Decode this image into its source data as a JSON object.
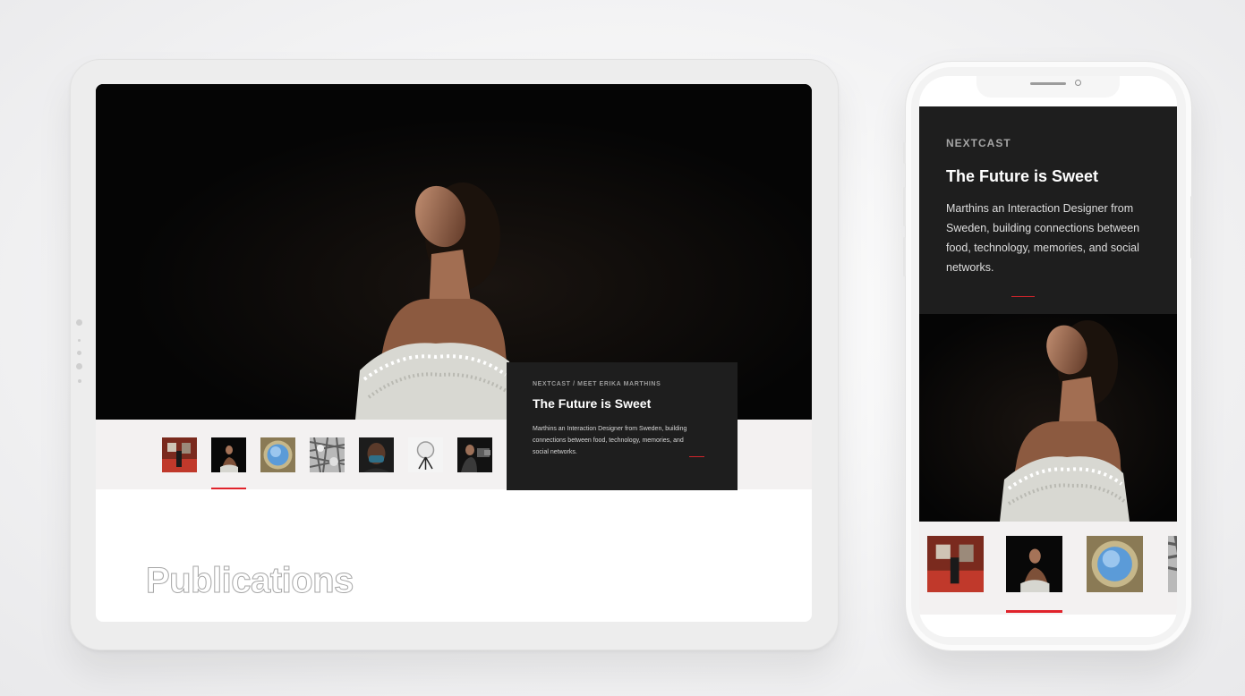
{
  "tablet": {
    "hero_image_label": "woman-looking-up-photo",
    "card": {
      "breadcrumb": "NEXTCAST / MEET ERIKA MARTHINS",
      "title": "The Future is Sweet",
      "description": "Marthins an Interaction Designer from Sweden, building connections between food, technology, memories, and social networks."
    },
    "thumbnails": [
      "red-gallery",
      "woman-portrait",
      "blue-circle",
      "patterned-texture",
      "masked-person",
      "glass-sculpture",
      "camera-operator"
    ],
    "active_thumbnail_index": 1,
    "section_title": "Publications"
  },
  "phone": {
    "card": {
      "breadcrumb": "NEXTCAST",
      "title": "The Future is Sweet",
      "description": "Marthins an Interaction Designer from Sweden, building connections between food, technology, memories, and social networks."
    },
    "thumbnails": [
      "red-gallery",
      "woman-portrait",
      "blue-circle",
      "patterned-texture"
    ],
    "active_thumbnail_index": 1
  },
  "colors": {
    "accent_red": "#e0232b",
    "card_dark": "#1e1e1e",
    "strip_bg": "#f3f1f1"
  }
}
